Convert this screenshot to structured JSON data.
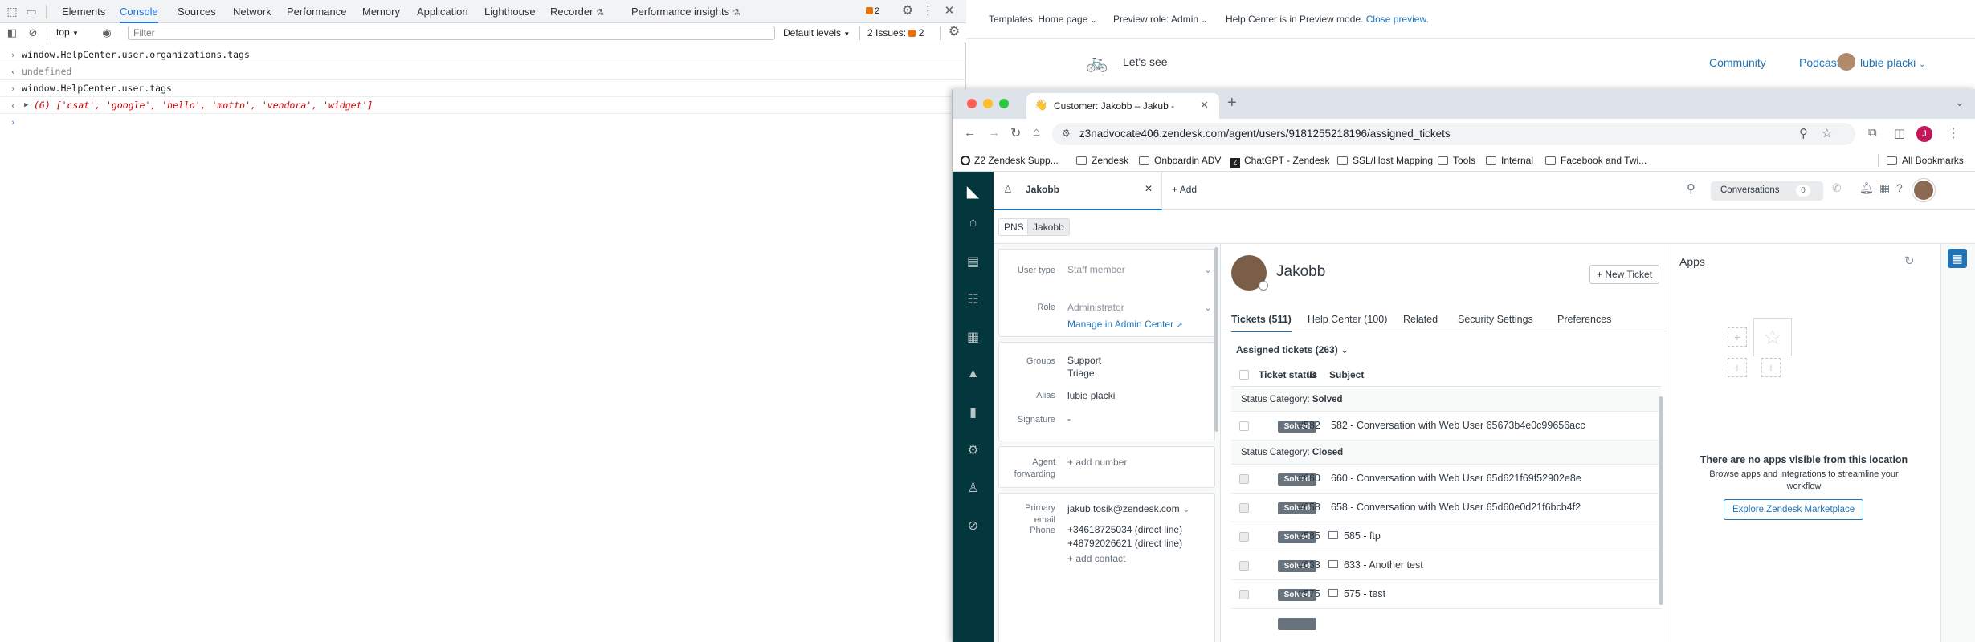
{
  "devtools": {
    "tabs": [
      "Elements",
      "Console",
      "Sources",
      "Network",
      "Performance",
      "Memory",
      "Application",
      "Lighthouse",
      "Recorder",
      "Performance insights"
    ],
    "active_tab": "Console",
    "issue_count_badge": "2",
    "context": "top",
    "filter_placeholder": "Filter",
    "default_levels": "Default levels",
    "issues_label": "2 Issues:",
    "issues_count": "2",
    "console": [
      {
        "type": "input",
        "text": "window.HelpCenter.user.organizations.tags"
      },
      {
        "type": "output",
        "text": "undefined"
      },
      {
        "type": "input",
        "text": "window.HelpCenter.user.tags"
      },
      {
        "type": "output",
        "text": "(6) ['csat', 'google', 'hello', 'motto', 'vendora', 'widget']"
      }
    ]
  },
  "helpcenter": {
    "templates": "Templates: Home page",
    "preview_role": "Preview role: Admin",
    "preview_notice": "Help Center is in Preview mode.",
    "close_preview": "Close preview.",
    "brand": "Let's see",
    "nav": [
      "Community",
      "Podcast"
    ],
    "user_name": "lubie placki"
  },
  "browser": {
    "tab_title": "Customer: Jakobb – Jakub -",
    "url": "z3nadvocate406.zendesk.com/agent/users/9181255218196/assigned_tickets",
    "profile_letter": "J",
    "bookmarks": [
      "Z2 Zendesk Supp...",
      "Zendesk",
      "Onboardin ADV",
      "ChatGPT - Zendesk",
      "SSL/Host Mapping",
      "Tools",
      "Internal",
      "Facebook and Twi..."
    ],
    "all_bookmarks": "All Bookmarks"
  },
  "zendesk": {
    "header_tab": "Jakobb",
    "add": "Add",
    "conversations": "Conversations",
    "conversations_count": "0",
    "crumbs": [
      "PNS",
      "Jakobb"
    ],
    "user_type_label": "User type",
    "user_type_value": "Staff member",
    "role_label": "Role",
    "role_value": "Administrator",
    "manage_link": "Manage in Admin Center",
    "groups_label": "Groups",
    "groups": [
      "Support",
      "Triage"
    ],
    "alias_label": "Alias",
    "alias_value": "lubie placki",
    "signature_label": "Signature",
    "signature_value": "-",
    "agent_fwd_label_1": "Agent",
    "agent_fwd_label_2": "forwarding",
    "agent_fwd_value": "+ add number",
    "primary_email_label_1": "Primary",
    "primary_email_label_2": "email",
    "primary_email_value": "jakub.tosik@zendesk.com",
    "phone_label": "Phone",
    "phones": [
      "+34618725034 (direct line)",
      "+48792026621 (direct line)"
    ],
    "add_contact": "+ add contact",
    "user_name": "Jakobb",
    "new_ticket": "+ New Ticket",
    "tabs": [
      "Tickets (511)",
      "Help Center (100)",
      "Related",
      "Security Settings",
      "Preferences"
    ],
    "assigned_label": "Assigned tickets (263)",
    "col_status": "Ticket status",
    "col_id": "ID",
    "col_subject": "Subject",
    "cat_prefix": "Status Category:",
    "cat_solved": "Solved",
    "cat_closed": "Closed",
    "solved_rows": [
      {
        "status": "Solved",
        "id": "#582",
        "subject": "582 - Conversation with Web User 65673b4e0c99656acc",
        "icon": ""
      }
    ],
    "closed_rows": [
      {
        "status": "Solved",
        "id": "#660",
        "subject": "660 - Conversation with Web User 65d621f69f52902e8e",
        "icon": ""
      },
      {
        "status": "Solved",
        "id": "#658",
        "subject": "658 - Conversation with Web User 65d60e0d21f6bcb4f2",
        "icon": ""
      },
      {
        "status": "Solved",
        "id": "#585",
        "subject": "585 - ftp",
        "icon": "email-icon"
      },
      {
        "status": "Solved",
        "id": "#633",
        "subject": "633 - Another test",
        "icon": "email-icon"
      },
      {
        "status": "Solved",
        "id": "#575",
        "subject": "575 - test",
        "icon": "email-icon"
      }
    ],
    "apps_title": "Apps",
    "apps_empty_title": "There are no apps visible from this location",
    "apps_empty_body": "Browse apps and integrations to streamline your workflow",
    "explore_button": "Explore Zendesk Marketplace"
  },
  "colors": {
    "devtools_active": "#1a73e8",
    "zendesk_rail": "#03363d",
    "zendesk_link": "#1f73b7",
    "status_badge": "#68737d"
  }
}
